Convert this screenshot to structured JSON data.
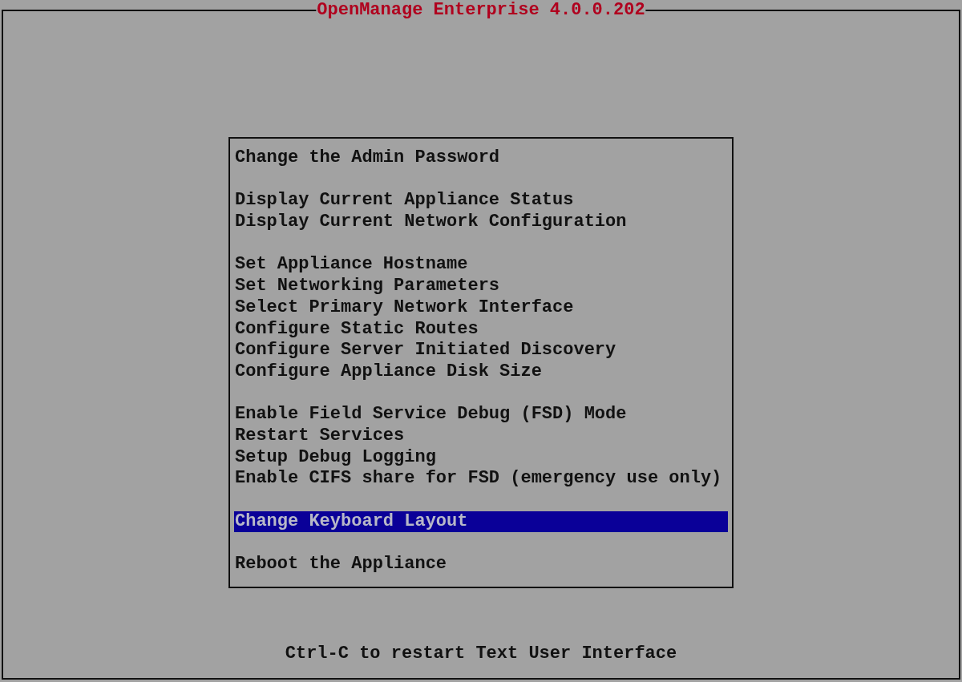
{
  "window": {
    "title": "OpenManage Enterprise 4.0.0.202"
  },
  "menu": {
    "groups": [
      [
        {
          "label": "Change the Admin Password",
          "selected": false
        }
      ],
      [
        {
          "label": "Display Current Appliance Status",
          "selected": false
        },
        {
          "label": "Display Current Network Configuration",
          "selected": false
        }
      ],
      [
        {
          "label": "Set Appliance Hostname",
          "selected": false
        },
        {
          "label": "Set Networking Parameters",
          "selected": false
        },
        {
          "label": "Select Primary Network Interface",
          "selected": false
        },
        {
          "label": "Configure Static Routes",
          "selected": false
        },
        {
          "label": "Configure Server Initiated Discovery",
          "selected": false
        },
        {
          "label": "Configure Appliance Disk Size",
          "selected": false
        }
      ],
      [
        {
          "label": "Enable Field Service Debug (FSD) Mode",
          "selected": false
        },
        {
          "label": "Restart Services",
          "selected": false
        },
        {
          "label": "Setup Debug Logging",
          "selected": false
        },
        {
          "label": "Enable CIFS share for FSD (emergency use only)",
          "selected": false
        }
      ],
      [
        {
          "label": "Change Keyboard Layout",
          "selected": true
        }
      ],
      [
        {
          "label": "Reboot the Appliance",
          "selected": false
        }
      ]
    ]
  },
  "footer": "Ctrl-C to restart Text User Interface"
}
